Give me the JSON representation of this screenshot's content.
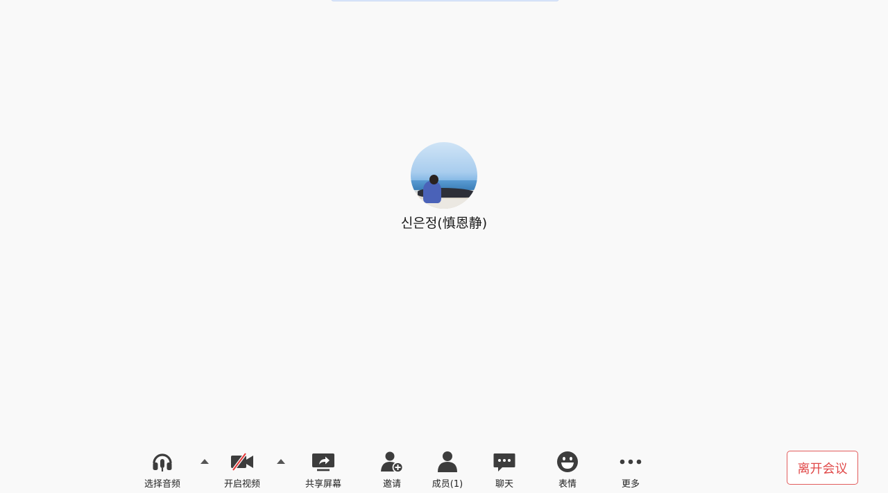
{
  "participant": {
    "name": "신은정(慎恩静)"
  },
  "toolbar": {
    "audio_label": "选择音频",
    "video_label": "开启视频",
    "share_label": "共享屏幕",
    "invite_label": "邀请",
    "members_label": "成员(1)",
    "chat_label": "聊天",
    "emoji_label": "表情",
    "more_label": "更多",
    "leave_label": "离开会议"
  },
  "colors": {
    "icon": "#3d3d3d",
    "leave_accent": "#e04848",
    "video_off_slash": "#e23b3b"
  },
  "icons": {
    "audio": "headset-icon",
    "video": "video-off-icon",
    "share": "share-screen-icon",
    "invite": "add-user-icon",
    "members": "user-icon",
    "chat": "chat-bubble-icon",
    "emoji": "smiley-icon",
    "more": "more-dots-icon"
  }
}
